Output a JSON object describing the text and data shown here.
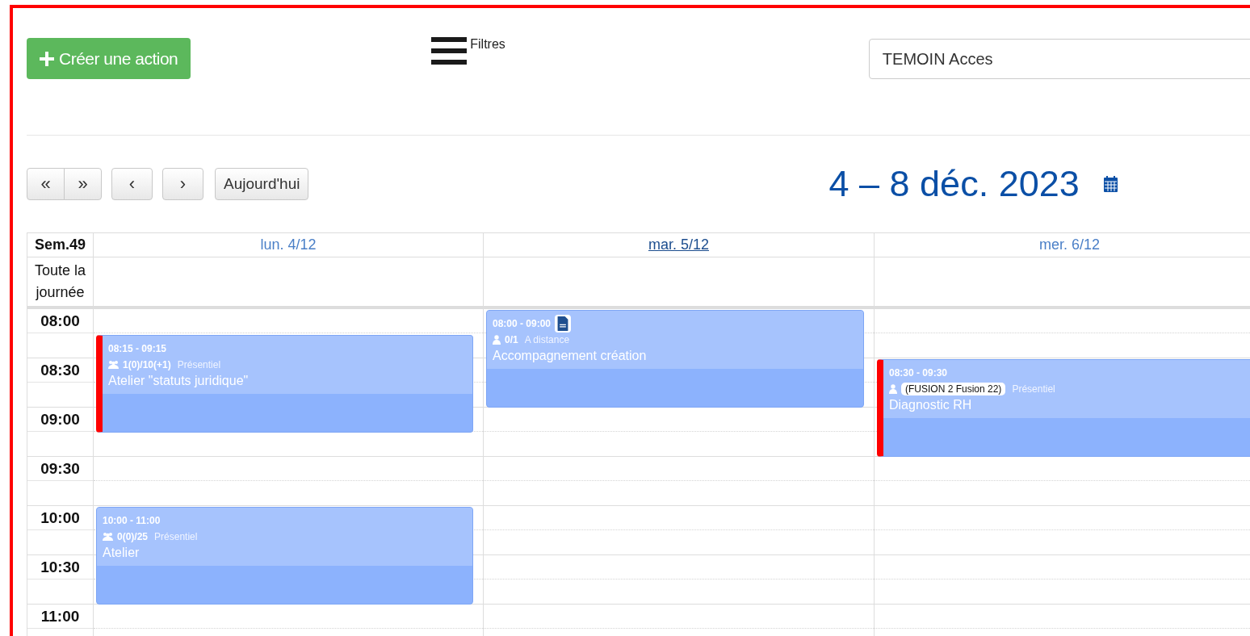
{
  "toolbar": {
    "create_button": "Créer une action",
    "filters_label": "Filtres",
    "search": {
      "value": "TEMOIN Acces"
    }
  },
  "navigation": {
    "buttons": [
      "«",
      "»",
      "‹",
      "›"
    ],
    "today_button": "Aujourd'hui",
    "date_range": "4 – 8 déc. 2023"
  },
  "calendar": {
    "week_label": "Sem.49",
    "all_day_label": "Toute la journée",
    "times": [
      "08:00",
      "08:30",
      "09:00",
      "09:30",
      "10:00",
      "10:30",
      "11:00"
    ],
    "days": [
      {
        "label": "lun. 4/12",
        "today": false,
        "events": [
          {
            "time": "08:15 - 09:15",
            "kind": "group",
            "attendees": "1(0)/10(+1)",
            "mode": "Présentiel",
            "title": "Atelier \"statuts juridique\"",
            "flagged": true,
            "has_document": false
          },
          {
            "time": "10:00 - 11:00",
            "kind": "group",
            "attendees": "0(0)/25",
            "mode": "Présentiel",
            "title": "Atelier",
            "flagged": false,
            "has_document": false
          }
        ]
      },
      {
        "label": "mar. 5/12",
        "today": true,
        "events": [
          {
            "time": "08:00 - 09:00",
            "kind": "person",
            "attendees": "0/1",
            "mode": "A distance",
            "title": "Accompagnement création",
            "flagged": false,
            "has_document": true
          }
        ]
      },
      {
        "label": "mer. 6/12",
        "today": false,
        "events": [
          {
            "time": "08:30 - 09:30",
            "kind": "person",
            "tag": "(FUSION 2 Fusion 22)",
            "mode": "Présentiel",
            "title": "Diagnostic RH",
            "flagged": true,
            "has_document": false
          }
        ]
      }
    ]
  }
}
